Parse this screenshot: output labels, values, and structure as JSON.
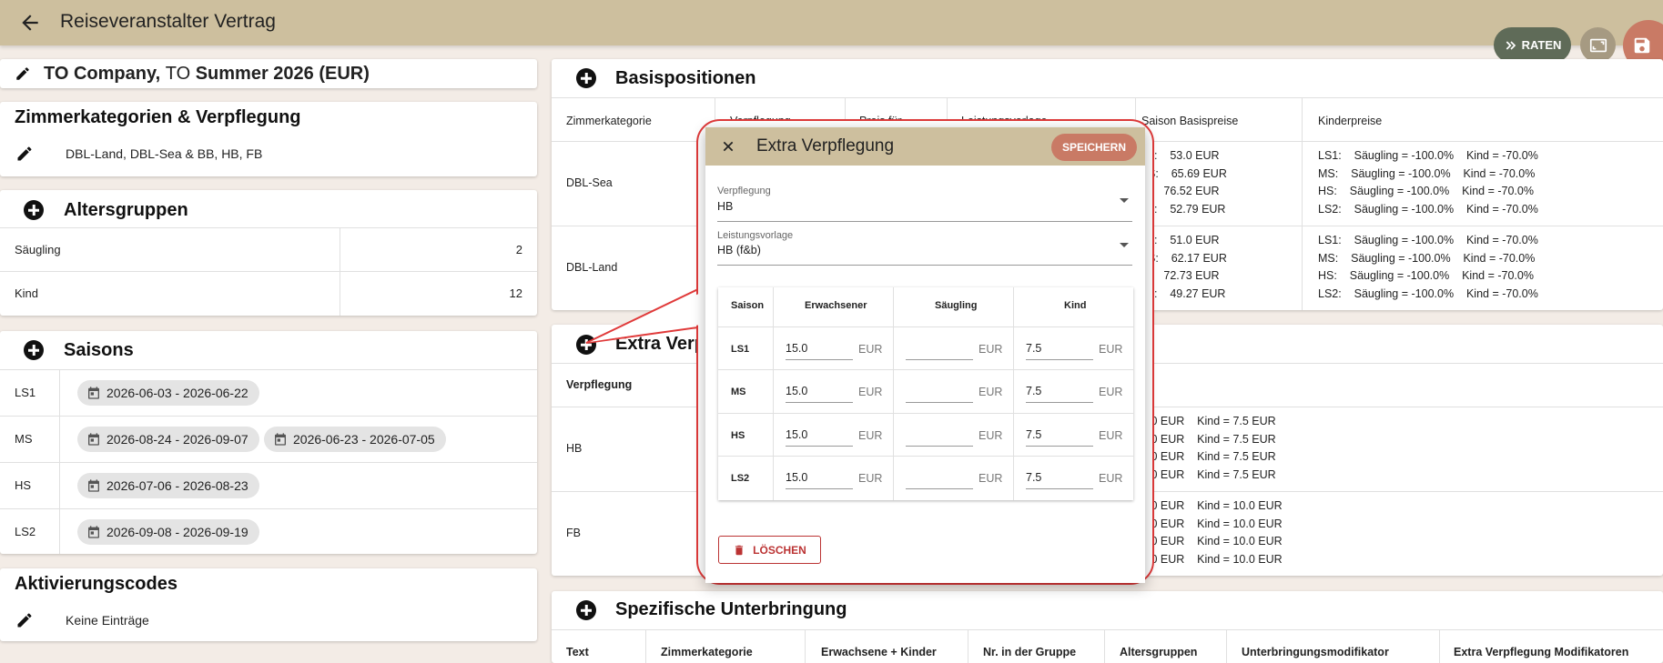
{
  "header": {
    "title": "Reiseveranstalter Vertrag",
    "raten_label": "RATEN"
  },
  "contract": {
    "prefix": "TO Company,",
    "to": "TO",
    "name": "Summer 2026 (EUR)"
  },
  "zimmer": {
    "title": "Zimmerkategorien & Verpflegung",
    "value": "DBL-Land, DBL-Sea & BB, HB, FB"
  },
  "alters": {
    "title": "Altersgruppen",
    "rows": [
      {
        "name": "Säugling",
        "value": "2"
      },
      {
        "name": "Kind",
        "value": "12"
      }
    ]
  },
  "saisons": {
    "title": "Saisons",
    "rows": [
      {
        "code": "LS1",
        "ranges": [
          "2026-06-03 - 2026-06-22"
        ]
      },
      {
        "code": "MS",
        "ranges": [
          "2026-08-24 - 2026-09-07",
          "2026-06-23 - 2026-07-05"
        ]
      },
      {
        "code": "HS",
        "ranges": [
          "2026-07-06 - 2026-08-23"
        ]
      },
      {
        "code": "LS2",
        "ranges": [
          "2026-09-08 - 2026-09-19"
        ]
      }
    ]
  },
  "aktivierung": {
    "title": "Aktivierungscodes",
    "value": "Keine Einträge"
  },
  "basis": {
    "title": "Basispositionen",
    "headers": [
      "Zimmerkategorie",
      "Verpflegung",
      "Preis für",
      "Leistungsvorlage",
      "Saison Basispreise",
      "Kinderpreise"
    ],
    "rows": [
      {
        "zimmer": "DBL-Sea",
        "prices": "1:    53.0 EUR\nS:    65.69 EUR\n:    76.52 EUR\n2:    52.79 EUR",
        "kinder": "LS1:    Säugling = -100.0%    Kind = -70.0%\nMS:    Säugling = -100.0%    Kind = -70.0%\nHS:    Säugling = -100.0%    Kind = -70.0%\nLS2:    Säugling = -100.0%    Kind = -70.0%"
      },
      {
        "zimmer": "DBL-Land",
        "prices": "1:    51.0 EUR\nS:    62.17 EUR\n:    72.73 EUR\n2:    49.27 EUR",
        "kinder": "LS1:    Säugling = -100.0%    Kind = -70.0%\nMS:    Säugling = -100.0%    Kind = -70.0%\nHS:    Säugling = -100.0%    Kind = -70.0%\nLS2:    Säugling = -100.0%    Kind = -70.0%"
      }
    ]
  },
  "extra": {
    "title": "Extra Verp",
    "header": "Verpflegung",
    "rows": [
      {
        "name": "HB",
        "prices": ".0 EUR    Kind = 7.5 EUR\n.0 EUR    Kind = 7.5 EUR\n.0 EUR    Kind = 7.5 EUR\n.0 EUR    Kind = 7.5 EUR"
      },
      {
        "name": "FB",
        "prices": ".0 EUR    Kind = 10.0 EUR\n.0 EUR    Kind = 10.0 EUR\n.0 EUR    Kind = 10.0 EUR\n.0 EUR    Kind = 10.0 EUR"
      }
    ]
  },
  "spez": {
    "title": "Spezifische Unterbringung",
    "headers": [
      "Text",
      "Zimmerkategorie",
      "Erwachsene + Kinder",
      "Nr. in der Gruppe",
      "Altersgruppen",
      "Unterbringungsmodifikator",
      "Extra Verpflegung Modifikatoren"
    ]
  },
  "dialog": {
    "title": "Extra Verpflegung",
    "save_label": "SPEICHERN",
    "verpflegung_label": "Verpflegung",
    "verpflegung_value": "HB",
    "leistung_label": "Leistungsvorlage",
    "leistung_value": "HB (f&b)",
    "table": {
      "headers": [
        "Saison",
        "Erwachsener",
        "Säugling",
        "Kind"
      ],
      "unit": "EUR",
      "rows": [
        {
          "saison": "LS1",
          "erw": "15.0",
          "saeug": "",
          "kind": "7.5"
        },
        {
          "saison": "MS",
          "erw": "15.0",
          "saeug": "",
          "kind": "7.5"
        },
        {
          "saison": "HS",
          "erw": "15.0",
          "saeug": "",
          "kind": "7.5"
        },
        {
          "saison": "LS2",
          "erw": "15.0",
          "saeug": "",
          "kind": "7.5"
        }
      ]
    },
    "delete_label": "LÖSCHEN"
  },
  "colors": {
    "header": "#cdbf9e",
    "accent": "#c97a65",
    "raten": "#5f6b58",
    "callout": "#e03a3a",
    "delete": "#bb3333"
  }
}
